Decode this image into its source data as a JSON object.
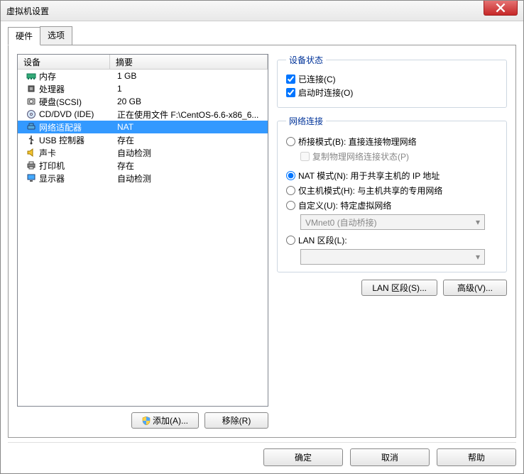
{
  "title": "虚拟机设置",
  "tabs": {
    "hardware": "硬件",
    "options": "选项"
  },
  "table": {
    "header": {
      "device": "设备",
      "summary": "摘要"
    },
    "rows": [
      {
        "icon": "memory-icon",
        "label": "内存",
        "summary": "1 GB"
      },
      {
        "icon": "cpu-icon",
        "label": "处理器",
        "summary": "1"
      },
      {
        "icon": "hdd-icon",
        "label": "硬盘(SCSI)",
        "summary": "20 GB"
      },
      {
        "icon": "cd-icon",
        "label": "CD/DVD (IDE)",
        "summary": "正在使用文件 F:\\CentOS-6.6-x86_6..."
      },
      {
        "icon": "network-icon",
        "label": "网络适配器",
        "summary": "NAT",
        "selected": true
      },
      {
        "icon": "usb-icon",
        "label": "USB 控制器",
        "summary": "存在"
      },
      {
        "icon": "sound-icon",
        "label": "声卡",
        "summary": "自动检测"
      },
      {
        "icon": "printer-icon",
        "label": "打印机",
        "summary": "存在"
      },
      {
        "icon": "display-icon",
        "label": "显示器",
        "summary": "自动检测"
      }
    ]
  },
  "left_buttons": {
    "add": "添加(A)...",
    "remove": "移除(R)"
  },
  "device_state": {
    "legend": "设备状态",
    "connected": "已连接(C)",
    "connect_at_power_on": "启动时连接(O)"
  },
  "net_conn": {
    "legend": "网络连接",
    "bridged": "桥接模式(B): 直接连接物理网络",
    "replicate": "复制物理网络连接状态(P)",
    "nat": "NAT 模式(N): 用于共享主机的 IP 地址",
    "hostonly": "仅主机模式(H): 与主机共享的专用网络",
    "custom": "自定义(U): 特定虚拟网络",
    "custom_combo": "VMnet0 (自动桥接)",
    "lan": "LAN 区段(L):",
    "lan_combo": ""
  },
  "right_buttons": {
    "lan_segments": "LAN 区段(S)...",
    "advanced": "高级(V)..."
  },
  "footer": {
    "ok": "确定",
    "cancel": "取消",
    "help": "帮助"
  }
}
